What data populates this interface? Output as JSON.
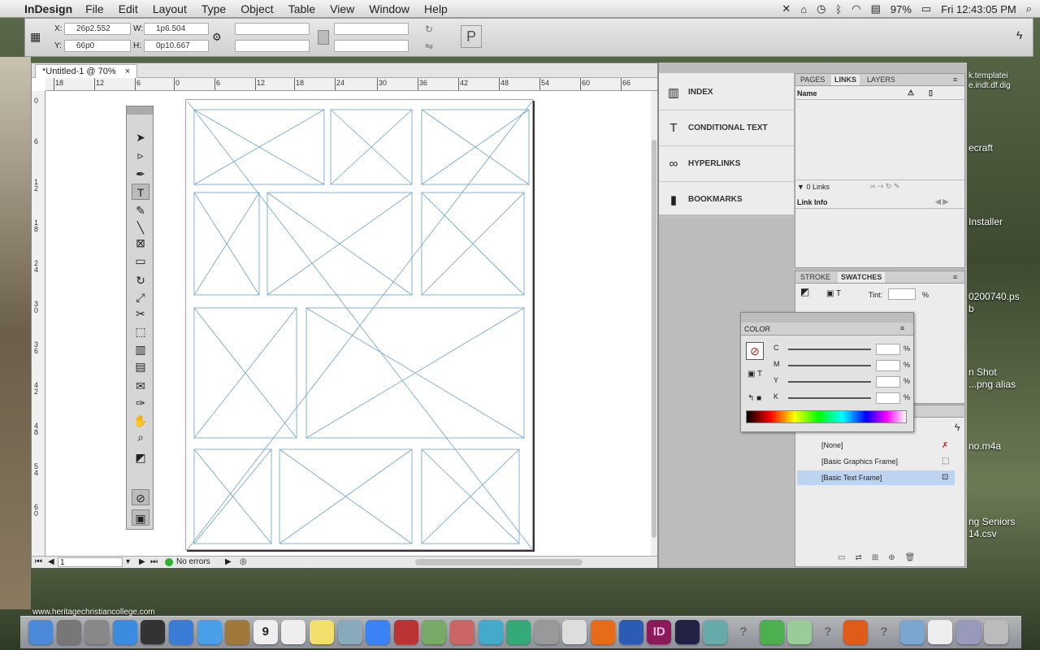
{
  "menubar": {
    "app": "InDesign",
    "items": [
      "File",
      "Edit",
      "Layout",
      "Type",
      "Object",
      "Table",
      "View",
      "Window",
      "Help"
    ],
    "battery": "97%",
    "clock": "Fri 12:43:05 PM"
  },
  "control": {
    "x_label": "X:",
    "x_value": "26p2.552",
    "y_label": "Y:",
    "y_value": "66p0",
    "w_label": "W:",
    "w_value": "1p6.504",
    "h_label": "H:",
    "h_value": "0p10.667",
    "p_glyph": "P"
  },
  "document": {
    "tab_title": "*Untitled-1 @ 70%",
    "close_glyph": "×",
    "h_ruler": [
      "18",
      "12",
      "6",
      "0",
      "6",
      "12",
      "18",
      "24",
      "30",
      "36",
      "42",
      "48",
      "54",
      "60",
      "66"
    ],
    "v_ruler": [
      "0",
      "6",
      "1\n2",
      "1\n8",
      "2\n4",
      "3\n0",
      "3\n6",
      "4\n2",
      "4\n8",
      "5\n4",
      "6\n0"
    ],
    "page_number": "1",
    "preflight": "No errors"
  },
  "side_panel": {
    "items": [
      {
        "icon": "index-icon",
        "label": "INDEX"
      },
      {
        "icon": "conditional-text-icon",
        "label": "CONDITIONAL TEXT"
      },
      {
        "icon": "hyperlinks-icon",
        "label": "HYPERLINKS"
      },
      {
        "icon": "bookmarks-icon",
        "label": "BOOKMARKS"
      }
    ]
  },
  "links_panel": {
    "tabs": [
      "PAGES",
      "LINKS",
      "LAYERS"
    ],
    "name_col": "Name",
    "count": "0 Links",
    "link_info": "Link Info"
  },
  "swatch_panel": {
    "tabs": [
      "STROKE",
      "SWATCHES"
    ],
    "tint_label": "Tint:",
    "percent": "%"
  },
  "color_panel": {
    "title": "COLOR",
    "channels": [
      "C",
      "M",
      "Y",
      "K"
    ],
    "percent": "%"
  },
  "object_styles": {
    "rows": [
      "[None]",
      "[Basic Graphics Frame]",
      "[Basic Text Frame]"
    ],
    "selected_index": 2
  },
  "desktop": {
    "labels": [
      "k.templatei",
      "e.indt.df.dig",
      "ecraft",
      "Installer",
      "0200740.ps",
      "b",
      "n Shot",
      "...png alias",
      "no.m4a",
      "ng Seniors",
      "14.csv"
    ],
    "website": "www.heritagechristiancollege.com"
  },
  "dock": {
    "items": [
      "Finder",
      "Launchpad",
      "Rocket",
      "App Store",
      "Dashboard",
      "Preview",
      "Safari",
      "Contacts",
      "Calendar",
      "Reminders",
      "Stickies",
      "Photo",
      "iTunes",
      "Photo Booth",
      "iPhoto",
      "Garageband",
      "Messages",
      "Time Machine",
      "Preferences",
      "Script",
      "Firefox",
      "Word",
      "InDesign",
      "QuickTime",
      "Image",
      "?",
      "Chrome",
      "Mail",
      "?",
      "Photoshop",
      "?",
      "Folder",
      "Document",
      "Screen",
      "Trash"
    ],
    "calendar_day": "9",
    "indesign_label": "ID"
  },
  "colors": {
    "frame_stroke": "#6aa0c8",
    "selection": "#bcd3f2"
  }
}
